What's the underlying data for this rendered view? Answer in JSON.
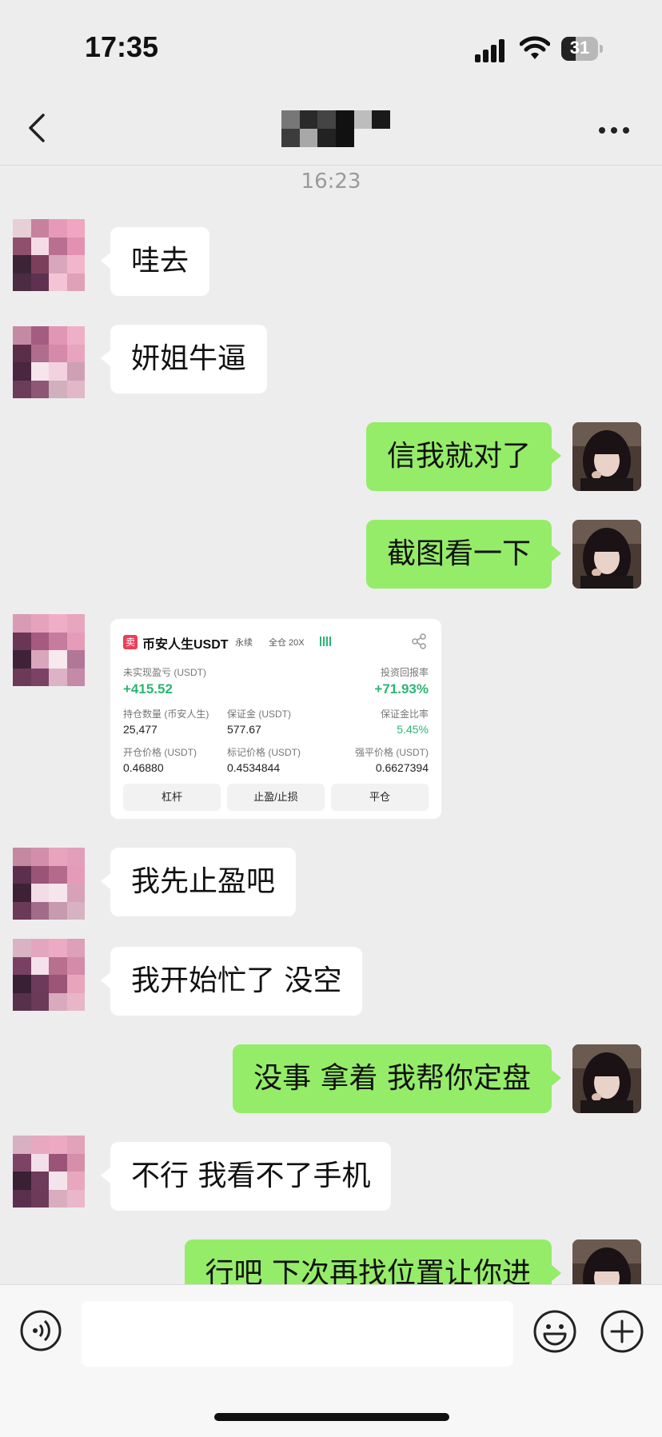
{
  "status": {
    "time": "17:35",
    "battery": "31"
  },
  "nav": {
    "title_hidden": ""
  },
  "chat": {
    "timestamp": "16:23",
    "messages": [
      {
        "side": "in",
        "text": "哇去"
      },
      {
        "side": "in",
        "text": "妍姐牛逼"
      },
      {
        "side": "out",
        "text": "信我就对了"
      },
      {
        "side": "out",
        "text": "截图看一下"
      },
      {
        "side": "in",
        "text": "[image]"
      },
      {
        "side": "in",
        "text": "我先止盈吧"
      },
      {
        "side": "in",
        "text": "我开始忙了 没空"
      },
      {
        "side": "out",
        "text": "没事 拿着 我帮你定盘"
      },
      {
        "side": "in",
        "text": "不行 我看不了手机"
      },
      {
        "side": "out",
        "text": "行吧 下次再找位置让你进"
      }
    ]
  },
  "card": {
    "sell_badge": "卖",
    "pair": "币安人生USDT",
    "tag_perp": "永续",
    "tag_margin": "全仓 20X",
    "unrealized_label": "未实现盈亏 (USDT)",
    "unrealized_value": "+415.52",
    "roi_label": "投资回报率",
    "roi_value": "+71.93%",
    "qty_label": "持仓数量 (币安人生)",
    "qty_value": "25,477",
    "margin_label": "保证金 (USDT)",
    "margin_value": "577.67",
    "margin_ratio_label": "保证金比率",
    "margin_ratio_value": "5.45%",
    "open_price_label": "开仓价格 (USDT)",
    "open_price_value": "0.46880",
    "mark_price_label": "标记价格 (USDT)",
    "mark_price_value": "0.4534844",
    "liq_price_label": "强平价格 (USDT)",
    "liq_price_value": "0.6627394",
    "btn_leverage": "杠杆",
    "btn_tpsl": "止盈/止损",
    "btn_close": "平仓"
  },
  "colors": {
    "bubble_out": "#95ec69",
    "bubble_in": "#ffffff",
    "profit": "#2bb673",
    "sell": "#e8425a"
  }
}
